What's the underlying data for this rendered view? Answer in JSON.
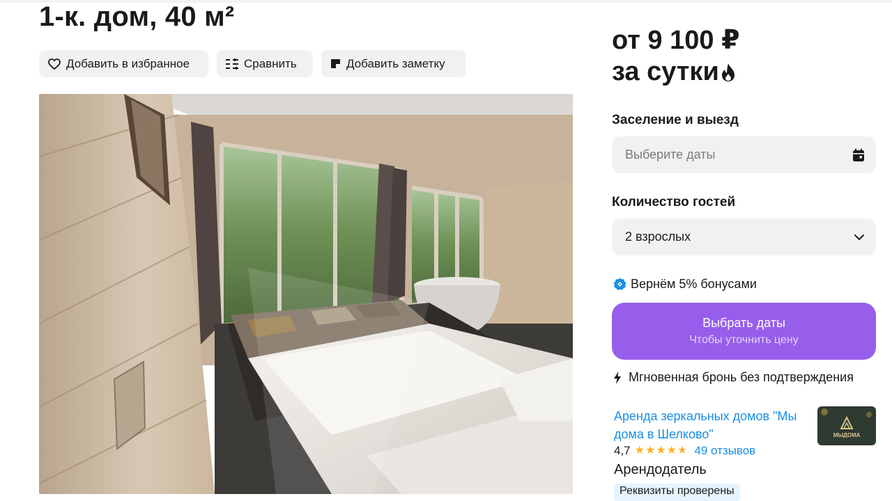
{
  "listing": {
    "title": "1-к. дом, 40 м²"
  },
  "actions": {
    "favorite_label": "Добавить в избранное",
    "compare_label": "Сравнить",
    "note_label": "Добавить заметку"
  },
  "photo": {
    "alt": "Спальня в деревянном доме"
  },
  "price": {
    "line1": "от 9 100 ₽",
    "line2": "за сутки"
  },
  "booking": {
    "dates_label": "Заселение и выезд",
    "dates_placeholder": "Выберите даты",
    "guests_label": "Количество гостей",
    "guests_value": "2 взрослых",
    "bonus_text": "Вернём 5% бонусами",
    "cta_label": "Выбрать даты",
    "cta_sublabel": "Чтобы уточнить цену",
    "instant_text": "Мгновенная бронь без подтверждения"
  },
  "seller": {
    "name": "Аренда зеркальных домов \"Мы дома в Шелково\"",
    "rating": "4,7",
    "rating_value": 4.7,
    "stars_total": 5,
    "reviews": "49 отзывов",
    "role": "Арендодатель",
    "verified_badge": "Реквизиты проверены",
    "logo_text": "МЫДОМА"
  },
  "colors": {
    "accent": "#965eeb",
    "link": "#1a8fe6",
    "star": "#ffb021",
    "bonus": "#1a8fe6"
  },
  "icons": {
    "favorite": "heart-icon",
    "compare": "compare-icon",
    "note": "note-icon",
    "hot": "fire-icon",
    "calendar": "calendar-icon",
    "dropdown": "chevron-down-icon",
    "bonus": "bonus-icon",
    "instant": "lightning-icon"
  }
}
